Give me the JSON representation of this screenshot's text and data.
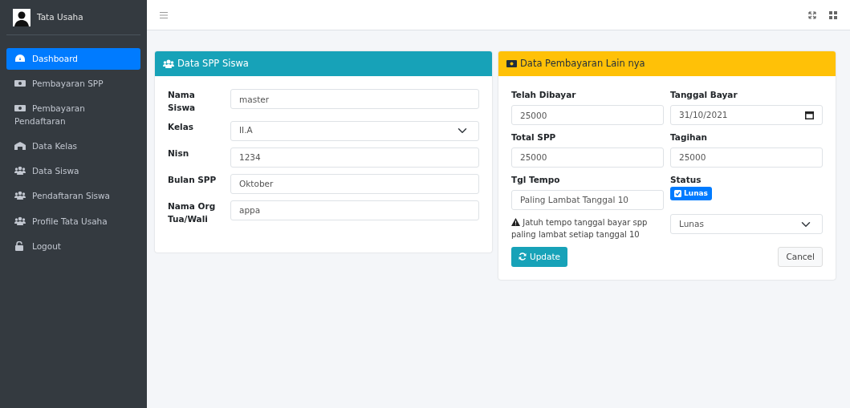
{
  "brand": {
    "title": "Tata Usaha"
  },
  "sidebar": {
    "items": [
      {
        "label": "Dashboard",
        "selected": true
      },
      {
        "label": "Pembayaran SPP",
        "selected": false
      },
      {
        "label": "Pembayaran Pendaftaran",
        "selected": false
      },
      {
        "label": "Data Kelas",
        "selected": false
      },
      {
        "label": "Data Siswa",
        "selected": false
      },
      {
        "label": "Pendaftaran Siswa",
        "selected": false
      },
      {
        "label": "Profile Tata Usaha",
        "selected": false
      },
      {
        "label": "Logout",
        "selected": false
      }
    ]
  },
  "student_card": {
    "title": "Data SPP Siswa",
    "fields": [
      {
        "label": "Nama Siswa",
        "value": "master",
        "kind": "text"
      },
      {
        "label": "Kelas",
        "value": "II.A",
        "kind": "select"
      },
      {
        "label": "Nisn",
        "value": "1234",
        "kind": "text"
      },
      {
        "label": "Bulan SPP",
        "value": "Oktober",
        "kind": "text"
      },
      {
        "label": "Nama Org Tua/Wali",
        "value": "appa",
        "kind": "text"
      }
    ]
  },
  "payment_card": {
    "title": "Data Pembayaran Lain nya",
    "telah_dibayar": {
      "label": "Telah Dibayar",
      "value": "25000"
    },
    "tanggal_bayar": {
      "label": "Tanggal Bayar",
      "value": "31/10/2021"
    },
    "total_spp": {
      "label": "Total SPP",
      "value": "25000"
    },
    "tagihan": {
      "label": "Tagihan",
      "value": "25000"
    },
    "tgl_tempo": {
      "label": "Tgl Tempo",
      "value": "Paling Lambat Tanggal 10"
    },
    "status": {
      "label": "Status",
      "badge": "Lunas",
      "checked": true,
      "select_value": "Lunas"
    },
    "note": "Jatuh tempo tanggal bayar spp paling lambat setiap tanggal 10",
    "buttons": {
      "update": "Update",
      "cancel": "Cancel"
    }
  }
}
